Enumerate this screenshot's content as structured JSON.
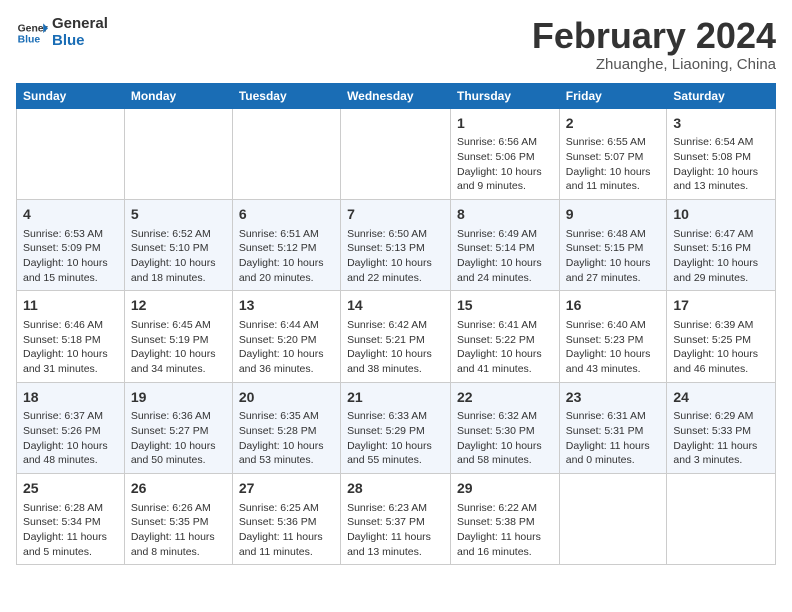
{
  "header": {
    "logo_line1": "General",
    "logo_line2": "Blue",
    "month": "February 2024",
    "location": "Zhuanghe, Liaoning, China"
  },
  "weekdays": [
    "Sunday",
    "Monday",
    "Tuesday",
    "Wednesday",
    "Thursday",
    "Friday",
    "Saturday"
  ],
  "weeks": [
    [
      {
        "num": "",
        "info": ""
      },
      {
        "num": "",
        "info": ""
      },
      {
        "num": "",
        "info": ""
      },
      {
        "num": "",
        "info": ""
      },
      {
        "num": "1",
        "info": "Sunrise: 6:56 AM\nSunset: 5:06 PM\nDaylight: 10 hours\nand 9 minutes."
      },
      {
        "num": "2",
        "info": "Sunrise: 6:55 AM\nSunset: 5:07 PM\nDaylight: 10 hours\nand 11 minutes."
      },
      {
        "num": "3",
        "info": "Sunrise: 6:54 AM\nSunset: 5:08 PM\nDaylight: 10 hours\nand 13 minutes."
      }
    ],
    [
      {
        "num": "4",
        "info": "Sunrise: 6:53 AM\nSunset: 5:09 PM\nDaylight: 10 hours\nand 15 minutes."
      },
      {
        "num": "5",
        "info": "Sunrise: 6:52 AM\nSunset: 5:10 PM\nDaylight: 10 hours\nand 18 minutes."
      },
      {
        "num": "6",
        "info": "Sunrise: 6:51 AM\nSunset: 5:12 PM\nDaylight: 10 hours\nand 20 minutes."
      },
      {
        "num": "7",
        "info": "Sunrise: 6:50 AM\nSunset: 5:13 PM\nDaylight: 10 hours\nand 22 minutes."
      },
      {
        "num": "8",
        "info": "Sunrise: 6:49 AM\nSunset: 5:14 PM\nDaylight: 10 hours\nand 24 minutes."
      },
      {
        "num": "9",
        "info": "Sunrise: 6:48 AM\nSunset: 5:15 PM\nDaylight: 10 hours\nand 27 minutes."
      },
      {
        "num": "10",
        "info": "Sunrise: 6:47 AM\nSunset: 5:16 PM\nDaylight: 10 hours\nand 29 minutes."
      }
    ],
    [
      {
        "num": "11",
        "info": "Sunrise: 6:46 AM\nSunset: 5:18 PM\nDaylight: 10 hours\nand 31 minutes."
      },
      {
        "num": "12",
        "info": "Sunrise: 6:45 AM\nSunset: 5:19 PM\nDaylight: 10 hours\nand 34 minutes."
      },
      {
        "num": "13",
        "info": "Sunrise: 6:44 AM\nSunset: 5:20 PM\nDaylight: 10 hours\nand 36 minutes."
      },
      {
        "num": "14",
        "info": "Sunrise: 6:42 AM\nSunset: 5:21 PM\nDaylight: 10 hours\nand 38 minutes."
      },
      {
        "num": "15",
        "info": "Sunrise: 6:41 AM\nSunset: 5:22 PM\nDaylight: 10 hours\nand 41 minutes."
      },
      {
        "num": "16",
        "info": "Sunrise: 6:40 AM\nSunset: 5:23 PM\nDaylight: 10 hours\nand 43 minutes."
      },
      {
        "num": "17",
        "info": "Sunrise: 6:39 AM\nSunset: 5:25 PM\nDaylight: 10 hours\nand 46 minutes."
      }
    ],
    [
      {
        "num": "18",
        "info": "Sunrise: 6:37 AM\nSunset: 5:26 PM\nDaylight: 10 hours\nand 48 minutes."
      },
      {
        "num": "19",
        "info": "Sunrise: 6:36 AM\nSunset: 5:27 PM\nDaylight: 10 hours\nand 50 minutes."
      },
      {
        "num": "20",
        "info": "Sunrise: 6:35 AM\nSunset: 5:28 PM\nDaylight: 10 hours\nand 53 minutes."
      },
      {
        "num": "21",
        "info": "Sunrise: 6:33 AM\nSunset: 5:29 PM\nDaylight: 10 hours\nand 55 minutes."
      },
      {
        "num": "22",
        "info": "Sunrise: 6:32 AM\nSunset: 5:30 PM\nDaylight: 10 hours\nand 58 minutes."
      },
      {
        "num": "23",
        "info": "Sunrise: 6:31 AM\nSunset: 5:31 PM\nDaylight: 11 hours\nand 0 minutes."
      },
      {
        "num": "24",
        "info": "Sunrise: 6:29 AM\nSunset: 5:33 PM\nDaylight: 11 hours\nand 3 minutes."
      }
    ],
    [
      {
        "num": "25",
        "info": "Sunrise: 6:28 AM\nSunset: 5:34 PM\nDaylight: 11 hours\nand 5 minutes."
      },
      {
        "num": "26",
        "info": "Sunrise: 6:26 AM\nSunset: 5:35 PM\nDaylight: 11 hours\nand 8 minutes."
      },
      {
        "num": "27",
        "info": "Sunrise: 6:25 AM\nSunset: 5:36 PM\nDaylight: 11 hours\nand 11 minutes."
      },
      {
        "num": "28",
        "info": "Sunrise: 6:23 AM\nSunset: 5:37 PM\nDaylight: 11 hours\nand 13 minutes."
      },
      {
        "num": "29",
        "info": "Sunrise: 6:22 AM\nSunset: 5:38 PM\nDaylight: 11 hours\nand 16 minutes."
      },
      {
        "num": "",
        "info": ""
      },
      {
        "num": "",
        "info": ""
      }
    ]
  ]
}
